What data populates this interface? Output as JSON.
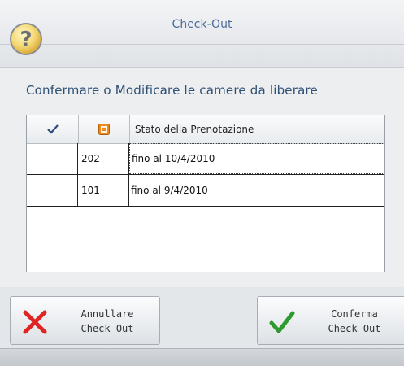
{
  "window": {
    "title": "Check-Out"
  },
  "icons": {
    "help": "question-icon",
    "cancel": "red-x-icon",
    "confirm": "green-check-icon"
  },
  "prompt": "Confermare o Modificare le camere da liberare",
  "grid": {
    "headers": {
      "check": "checkmark-icon",
      "room": "room-status-icon",
      "status": "Stato della Prenotazione"
    },
    "rows": [
      {
        "checked": "",
        "room": "202",
        "status": "fino al 10/4/2010"
      },
      {
        "checked": "",
        "room": "101",
        "status": "fino al 9/4/2010"
      }
    ]
  },
  "buttons": {
    "cancel": {
      "line1": "Annullare",
      "line2": "Check-Out"
    },
    "confirm": {
      "line1": "Conferma",
      "line2": "Check-Out"
    }
  },
  "colors": {
    "accent": "#4a6c9a",
    "cancel": "#e02424",
    "confirm": "#2e9a2e",
    "room_icon": "#f08a1c"
  }
}
